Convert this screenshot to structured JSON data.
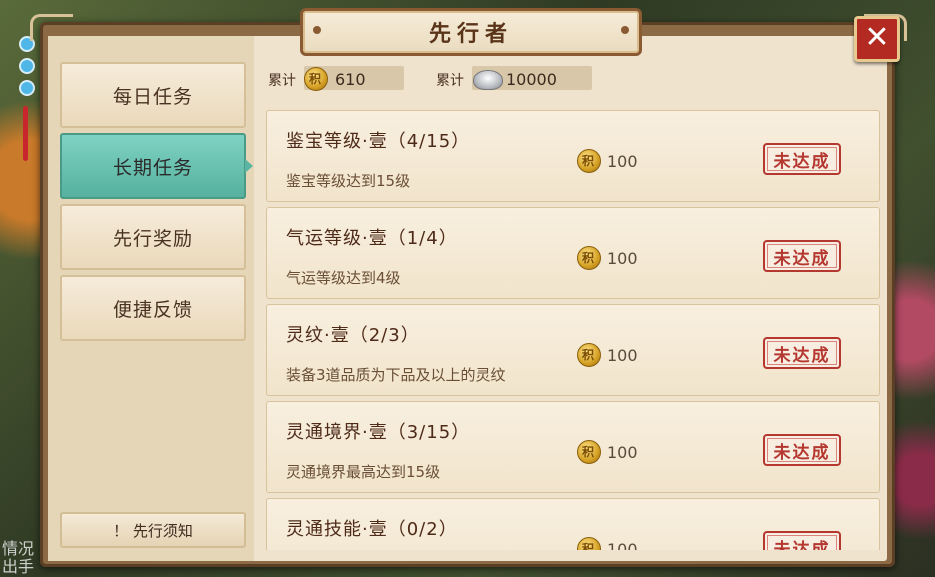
{
  "window": {
    "title": "先行者",
    "close_label": "✕"
  },
  "sidebar": {
    "tabs": [
      {
        "label": "每日任务",
        "active": false
      },
      {
        "label": "长期任务",
        "active": true
      },
      {
        "label": "先行奖励",
        "active": false
      },
      {
        "label": "便捷反馈",
        "active": false
      }
    ],
    "notice_label": "！ 先行须知"
  },
  "totals": {
    "points_label": "累计",
    "points_value": "610",
    "silver_label": "累计",
    "silver_value": "10000"
  },
  "tasks": [
    {
      "title": "鉴宝等级·壹（4/15）",
      "desc": "鉴宝等级达到15级",
      "reward": "100",
      "status": "未达成"
    },
    {
      "title": "气运等级·壹（1/4）",
      "desc": "气运等级达到4级",
      "reward": "100",
      "status": "未达成"
    },
    {
      "title": "灵纹·壹（2/3）",
      "desc": "装备3道品质为下品及以上的灵纹",
      "reward": "100",
      "status": "未达成"
    },
    {
      "title": "灵通境界·壹（3/15）",
      "desc": "灵通境界最高达到15级",
      "reward": "100",
      "status": "未达成"
    },
    {
      "title": "灵通技能·壹（0/2）",
      "desc": "",
      "reward": "100",
      "status": "未达成"
    }
  ],
  "background_text": "情况\n出手"
}
